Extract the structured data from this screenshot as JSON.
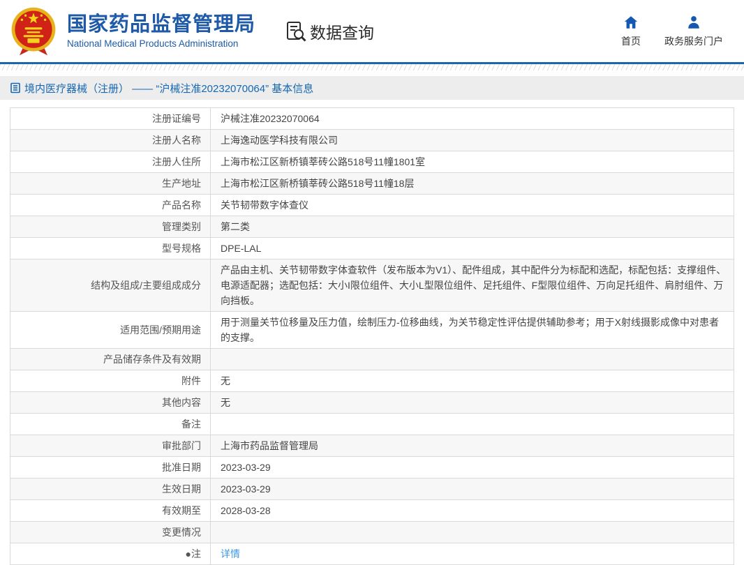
{
  "header": {
    "title": "国家药品监督管理局",
    "subtitle": "National Medical Products Administration",
    "section_label": "数据查询",
    "nav": [
      {
        "label": "首页",
        "icon": "home-icon"
      },
      {
        "label": "政务服务门户",
        "icon": "user-icon"
      }
    ]
  },
  "breadcrumb": {
    "icon": "document-list-icon",
    "text": "境内医疗器械（注册） —— “沪械注准20232070064” 基本信息"
  },
  "table": {
    "rows": [
      {
        "label": "注册证编号",
        "value": "沪械注准20232070064",
        "type": "text"
      },
      {
        "label": "注册人名称",
        "value": "上海逸动医学科技有限公司",
        "type": "text"
      },
      {
        "label": "注册人住所",
        "value": "上海市松江区新桥镇莘砖公路518号11幢1801室",
        "type": "text"
      },
      {
        "label": "生产地址",
        "value": "上海市松江区新桥镇莘砖公路518号11幢18层",
        "type": "text"
      },
      {
        "label": "产品名称",
        "value": "关节韧带数字体查仪",
        "type": "text"
      },
      {
        "label": "管理类别",
        "value": "第二类",
        "type": "text"
      },
      {
        "label": "型号规格",
        "value": "DPE-LAL",
        "type": "text"
      },
      {
        "label": "结构及组成/主要组成成分",
        "value": "产品由主机、关节韧带数字体查软件（发布版本为V1）、配件组成，其中配件分为标配和选配，标配包括：支撑组件、电源适配器；选配包括：大小I限位组件、大小L型限位组件、足托组件、F型限位组件、万向足托组件、肩肘组件、万向挡板。",
        "type": "text"
      },
      {
        "label": "适用范围/预期用途",
        "value": "用于测量关节位移量及压力值，绘制压力-位移曲线，为关节稳定性评估提供辅助参考；用于X射线摄影成像中对患者的支撑。",
        "type": "text"
      },
      {
        "label": "产品储存条件及有效期",
        "value": "",
        "type": "empty"
      },
      {
        "label": "附件",
        "value": "无",
        "type": "text"
      },
      {
        "label": "其他内容",
        "value": "无",
        "type": "text"
      },
      {
        "label": "备注",
        "value": "",
        "type": "empty"
      },
      {
        "label": "审批部门",
        "value": "上海市药品监督管理局",
        "type": "text"
      },
      {
        "label": "批准日期",
        "value": "2023-03-29",
        "type": "text"
      },
      {
        "label": "生效日期",
        "value": "2023-03-29",
        "type": "text"
      },
      {
        "label": "有效期至",
        "value": "2028-03-28",
        "type": "text"
      },
      {
        "label": "变更情况",
        "value": "",
        "type": "empty"
      },
      {
        "label": "●注",
        "value": "详情",
        "type": "link"
      }
    ]
  },
  "colors": {
    "brand_blue": "#1e5aa8",
    "header_rule_blue": "#1b67ae",
    "breadcrumb_blue": "#1668b3",
    "icon_blue": "#1558b0",
    "detail_link_blue": "#3e97e8",
    "row_alt_gray": "#f7f7f7",
    "border_gray": "#d9d9d9"
  }
}
